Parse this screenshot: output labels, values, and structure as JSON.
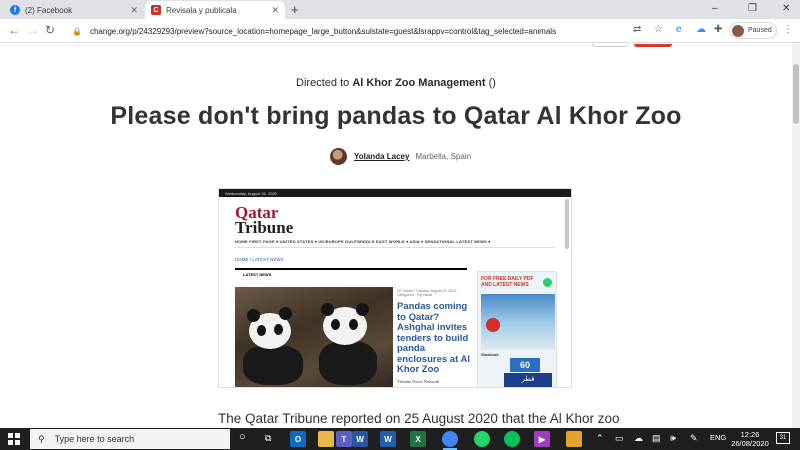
{
  "browser": {
    "tabs": [
      {
        "label": "(2) Facebook",
        "favicon": "facebook-icon",
        "color": "#1877f2"
      },
      {
        "label": "Revisala y publicala",
        "favicon": "change-org-icon",
        "color": "#c8302b",
        "active": true
      }
    ],
    "new_tab": "+",
    "window_controls": {
      "minimize": "–",
      "maximize": "❐",
      "close": "✕"
    },
    "url": "change.org/p/24329293/preview?source_location=homepage_large_button&sulstate=guest&lsrappv=control&tag_selected=animals",
    "profile_status": "Paused"
  },
  "page": {
    "directed_prefix": "Directed to",
    "directed_target": "Al Khor Zoo Management",
    "directed_suffix": "()",
    "title": "Please don't bring pandas to Qatar Al Khor Zoo",
    "author_name": "Yolanda Lacey",
    "author_location": "Marbella, Spain",
    "paragraph": "The Qatar Tribune reported on 25 August 2020 that the Al Khor zoo"
  },
  "newspaper": {
    "topbar_date": "Wednesday, August 26, 2020",
    "logo_line1": "Qatar",
    "logo_line2": "Tribune",
    "menu": "HOME   FIRST PAGE ▾   UNITED STATES ▾   UK/EUROPE   GULF/MIDDLE EAST   WORLD ▾   ASIA ▾   SENSATIONAL   LATEST NEWS ▾",
    "breadcrumb": "HOME / LATEST NEWS",
    "section_label": "LATEST NEWS",
    "meta": "QT Online / Tuesday, August 25, 2020 / Categories : Top News",
    "headline": "Pandas coming to Qatar? Ashghal invites tenders to build panda enclosures at Al Khor Zoo",
    "byline": "Tribune News Network",
    "ad_heading": "FOR FREE DAILY PDF AND LATEST NEWS",
    "ad_product": "Storbook",
    "ad_number": "60",
    "ad_arabic": "قطر"
  },
  "taskbar": {
    "search_placeholder": "Type here to search",
    "language": "ENG",
    "time": "12:26",
    "date": "26/08/2020",
    "notification_count": "31"
  }
}
